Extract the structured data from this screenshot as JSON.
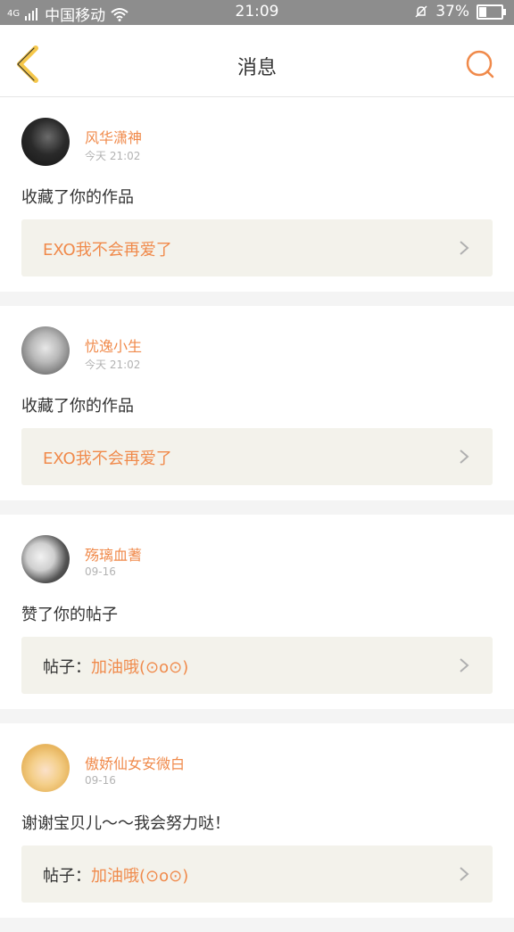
{
  "status_bar": {
    "carrier": "中国移动",
    "network": "4G",
    "time": "21:09",
    "battery": "37%"
  },
  "nav": {
    "title": "消息"
  },
  "messages": [
    {
      "user": "风华潇神",
      "time": "今天 21:02",
      "action": "收藏了你的作品",
      "target_prefix": "",
      "target": "EXO我不会再爱了"
    },
    {
      "user": "忧逸小生",
      "time": "今天 21:02",
      "action": "收藏了你的作品",
      "target_prefix": "",
      "target": "EXO我不会再爱了"
    },
    {
      "user": "殇璃血蓍",
      "time": "09-16",
      "action": "赞了你的帖子",
      "target_prefix": "帖子：",
      "target": "加油哦(⊙o⊙)"
    },
    {
      "user": "傲娇仙女安微白",
      "time": "09-16",
      "action": "谢谢宝贝儿～～我会努力哒！",
      "target_prefix": "帖子：",
      "target": "加油哦(⊙o⊙)"
    }
  ],
  "colors": {
    "accent": "#f08a4b",
    "back_icon": "#f5c74a",
    "status_bar": "#8d8d8d"
  }
}
